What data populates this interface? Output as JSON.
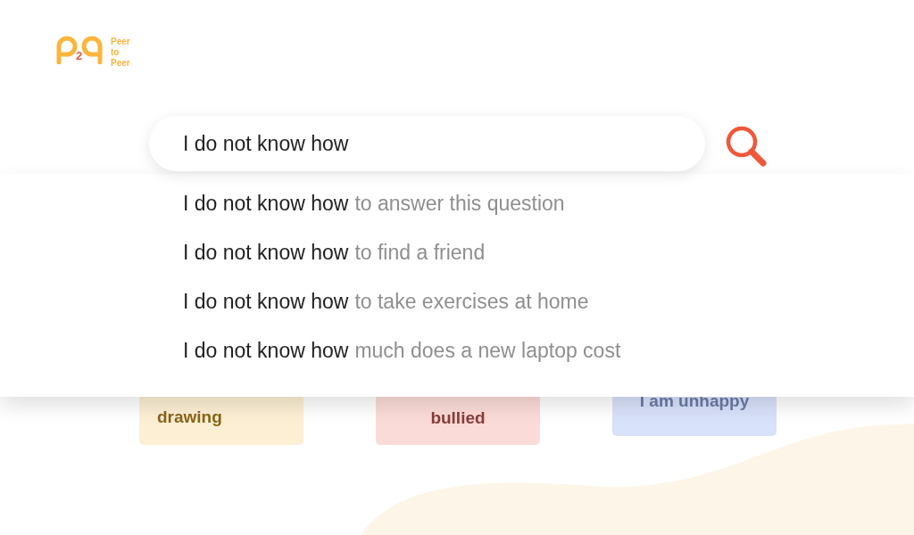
{
  "logo": {
    "mark_digit": "2",
    "name_lines": [
      "Peer",
      "to",
      "Peer"
    ]
  },
  "search": {
    "value": "I do not know how"
  },
  "suggestions": [
    {
      "typed": "I do not know how",
      "completion": "to answer this question"
    },
    {
      "typed": "I do not know how",
      "completion": "to find a friend"
    },
    {
      "typed": "I do not know how",
      "completion": "to take exercises at home"
    },
    {
      "typed": "I do not know how",
      "completion": "much does a new laptop cost"
    }
  ],
  "topic_cards": [
    {
      "text": "drawing",
      "color": "#fcefd4"
    },
    {
      "text": "bullied",
      "color": "#fbdbd7"
    },
    {
      "text": "I am unhappy",
      "color": "#d9e2fb"
    }
  ]
}
